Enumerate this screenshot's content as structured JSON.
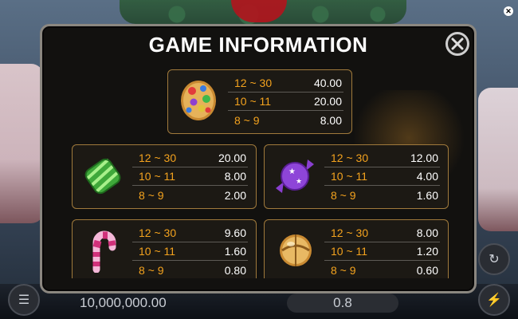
{
  "modal": {
    "title": "GAME INFORMATION"
  },
  "background": {
    "balance": "10,000,000.00",
    "bet": "0.8"
  },
  "paytable": [
    {
      "symbol": "cookie-candy-icon",
      "rows": [
        {
          "range": "12 ~ 30",
          "value": "40.00"
        },
        {
          "range": "10 ~ 11",
          "value": "20.00"
        },
        {
          "range": "8 ~ 9",
          "value": "8.00"
        }
      ]
    },
    {
      "symbol": "green-striped-candy-icon",
      "rows": [
        {
          "range": "12 ~ 30",
          "value": "20.00"
        },
        {
          "range": "10 ~ 11",
          "value": "8.00"
        },
        {
          "range": "8 ~ 9",
          "value": "2.00"
        }
      ]
    },
    {
      "symbol": "purple-wrapped-candy-icon",
      "rows": [
        {
          "range": "12 ~ 30",
          "value": "12.00"
        },
        {
          "range": "10 ~ 11",
          "value": "4.00"
        },
        {
          "range": "8 ~ 9",
          "value": "1.60"
        }
      ]
    },
    {
      "symbol": "candy-cane-icon",
      "rows": [
        {
          "range": "12 ~ 30",
          "value": "9.60"
        },
        {
          "range": "10 ~ 11",
          "value": "1.60"
        },
        {
          "range": "8 ~ 9",
          "value": "0.80"
        }
      ]
    },
    {
      "symbol": "gold-bell-candy-icon",
      "rows": [
        {
          "range": "12 ~ 30",
          "value": "8.00"
        },
        {
          "range": "10 ~ 11",
          "value": "1.20"
        },
        {
          "range": "8 ~ 9",
          "value": "0.60"
        }
      ]
    }
  ],
  "colors": {
    "range_text": "#f3a21e",
    "card_border": "#a07a3c",
    "modal_border": "#8b8780"
  }
}
